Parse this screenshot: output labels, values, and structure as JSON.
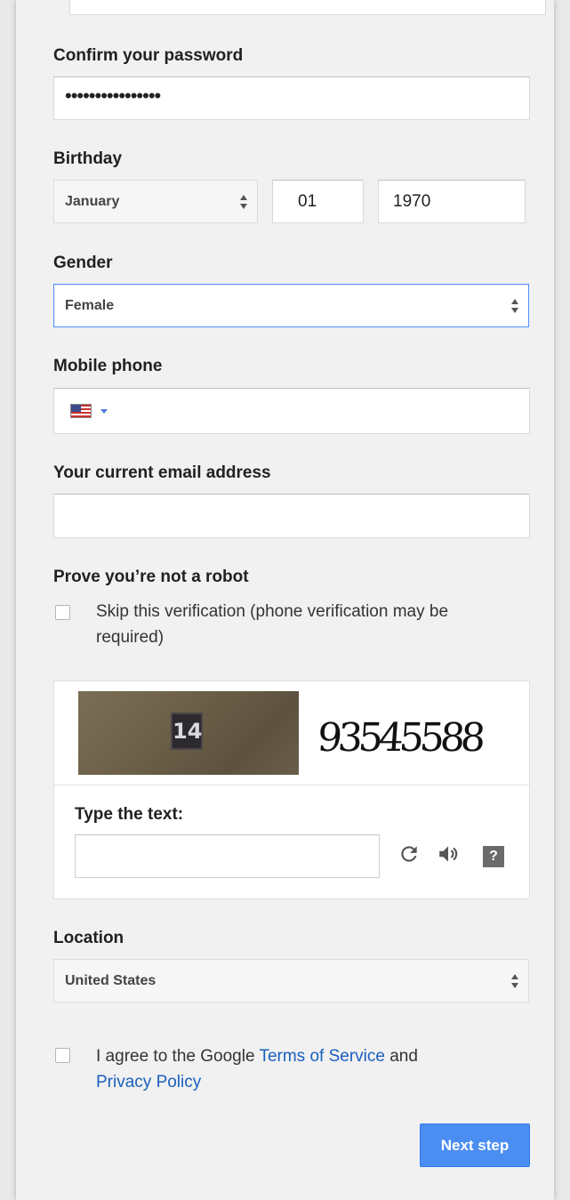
{
  "confirm_password": {
    "label": "Confirm your password",
    "value": "••••••••••••••••"
  },
  "birthday": {
    "label": "Birthday",
    "month": "January",
    "day": "01",
    "year": "1970"
  },
  "gender": {
    "label": "Gender",
    "value": "Female"
  },
  "mobile_phone": {
    "label": "Mobile phone",
    "country_icon": "us-flag-icon",
    "value": ""
  },
  "current_email": {
    "label": "Your current email address",
    "value": ""
  },
  "robot": {
    "label": "Prove you’re not a robot",
    "skip_line1": "Skip this verification (phone verification may be",
    "skip_line2": "required)"
  },
  "captcha": {
    "photo_text": "14",
    "challenge_text": "93545588",
    "type_label": "Type the text:",
    "input_value": "",
    "icons": [
      "refresh-icon",
      "audio-icon",
      "help-icon"
    ]
  },
  "location": {
    "label": "Location",
    "value": "United States"
  },
  "terms": {
    "prefix": "I agree to the Google",
    "tos_link": "Terms of Service",
    "and": "and",
    "privacy_link": "Privacy Policy"
  },
  "next_button": "Next step",
  "colors": {
    "accent": "#4b8ef1",
    "link": "#1a5fbf",
    "focus_border": "#4d90fe"
  }
}
